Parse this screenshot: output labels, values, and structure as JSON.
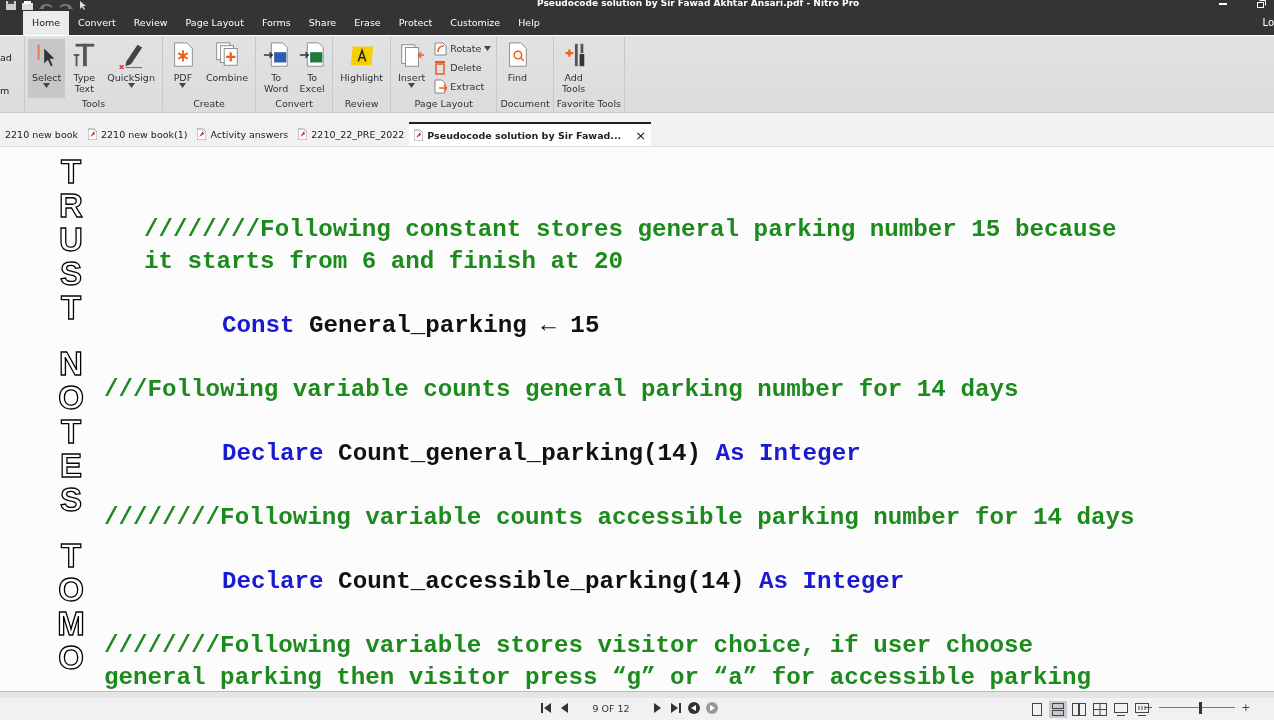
{
  "window": {
    "title": "Pseudocode solution by  Sir Fawad Akhtar Ansari.pdf - Nitro Pro",
    "account": "Lo"
  },
  "ribbon_tabs": [
    {
      "label": "Home",
      "selected": true
    },
    {
      "label": "Convert",
      "selected": false
    },
    {
      "label": "Review",
      "selected": false
    },
    {
      "label": "Page Layout",
      "selected": false
    },
    {
      "label": "Forms",
      "selected": false
    },
    {
      "label": "Share",
      "selected": false
    },
    {
      "label": "Erase",
      "selected": false
    },
    {
      "label": "Protect",
      "selected": false
    },
    {
      "label": "Customize",
      "selected": false
    },
    {
      "label": "Help",
      "selected": false
    }
  ],
  "ribbon_cut_group": [
    "ad",
    "m"
  ],
  "ribbon_groups": [
    {
      "label": "Tools",
      "buttons": [
        {
          "label": "Select",
          "kind": "large",
          "dropdown": true,
          "selected": true
        },
        {
          "label": "Type\nText",
          "kind": "large",
          "dropdown": false,
          "selected": false
        },
        {
          "label": "QuickSign",
          "kind": "large",
          "dropdown": true,
          "selected": false
        }
      ]
    },
    {
      "label": "Create",
      "buttons": [
        {
          "label": "PDF",
          "kind": "large",
          "dropdown": true,
          "selected": false
        },
        {
          "label": "Combine",
          "kind": "large",
          "dropdown": false,
          "selected": false
        }
      ]
    },
    {
      "label": "Convert",
      "buttons": [
        {
          "label": "To\nWord",
          "kind": "large",
          "dropdown": false,
          "selected": false
        },
        {
          "label": "To\nExcel",
          "kind": "large",
          "dropdown": false,
          "selected": false
        }
      ]
    },
    {
      "label": "Review",
      "buttons": [
        {
          "label": "Highlight",
          "kind": "large",
          "dropdown": false,
          "selected": false
        }
      ]
    },
    {
      "label": "Page Layout",
      "buttons": [
        {
          "label": "Insert",
          "kind": "large",
          "dropdown": true,
          "selected": false
        },
        {
          "label": "Rotate",
          "kind": "small",
          "dropdown": true,
          "selected": false
        },
        {
          "label": "Delete",
          "kind": "small",
          "dropdown": false,
          "selected": false
        },
        {
          "label": "Extract",
          "kind": "small",
          "dropdown": false,
          "selected": false
        }
      ]
    },
    {
      "label": "Document",
      "buttons": [
        {
          "label": "Find",
          "kind": "large",
          "dropdown": false,
          "selected": false
        }
      ]
    },
    {
      "label": "Favorite Tools",
      "buttons": [
        {
          "label": "Add\nTools",
          "kind": "large",
          "dropdown": false,
          "selected": false
        }
      ]
    }
  ],
  "document_tabs": [
    {
      "label": "2210 new book",
      "selected": false
    },
    {
      "label": "2210 new book(1)",
      "selected": false
    },
    {
      "label": "Activity answers",
      "selected": false
    },
    {
      "label": "2210_22_PRE_2022",
      "selected": false
    },
    {
      "label": "Pseudocode solution by  Sir Fawad...",
      "selected": true,
      "close": "×"
    }
  ],
  "document": {
    "side_words": [
      "TRUST",
      "NOTES",
      "TOMO"
    ],
    "blocks": [
      {
        "kind": "indented_comment",
        "lines": [
          "////////Following constant stores general parking number 15 because",
          "it starts from 6 and finish at 20"
        ]
      },
      {
        "kind": "code",
        "segments": [
          {
            "kind": "keyword",
            "text": "Const"
          },
          {
            "kind": "plain",
            "text": " General_parking "
          },
          {
            "kind": "plain",
            "text": "←"
          },
          {
            "kind": "plain",
            "text": " 15"
          }
        ]
      },
      {
        "kind": "comment",
        "lines": [
          "///Following variable counts general parking number for 14 days"
        ]
      },
      {
        "kind": "code",
        "segments": [
          {
            "kind": "keyword",
            "text": "Declare"
          },
          {
            "kind": "plain",
            "text": " Count_general_parking(14) "
          },
          {
            "kind": "keyword",
            "text": "As Integer"
          }
        ]
      },
      {
        "kind": "comment",
        "lines": [
          "////////Following variable counts accessible parking number for 14 days"
        ]
      },
      {
        "kind": "code",
        "segments": [
          {
            "kind": "keyword",
            "text": "Declare"
          },
          {
            "kind": "plain",
            "text": " Count_accessible_parking(14) "
          },
          {
            "kind": "keyword",
            "text": "As Integer"
          }
        ]
      },
      {
        "kind": "comment",
        "lines": [
          "////////Following variable stores visitor choice, if user choose",
          "general parking then visitor press “g” or “a” for accessible parking"
        ]
      }
    ]
  },
  "status_bar": {
    "page": "9 OF 12",
    "views": [
      {
        "selected": false
      },
      {
        "selected": true
      },
      {
        "selected": false
      },
      {
        "selected": false
      },
      {
        "selected": false
      },
      {
        "selected": false
      }
    ],
    "zoom_minus": "−",
    "zoom_plus": "+",
    "zoom": {
      "level": 0.55
    }
  }
}
